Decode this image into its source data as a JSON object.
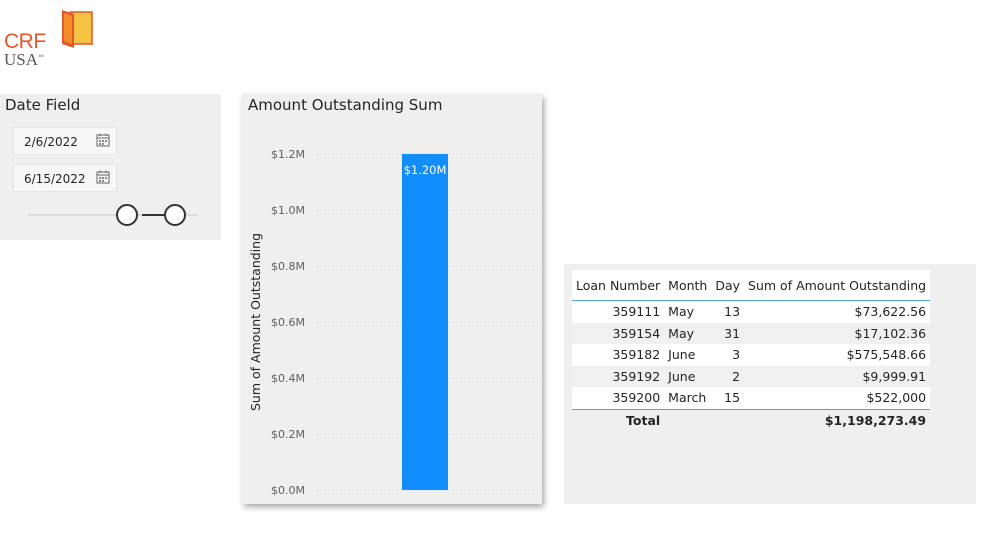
{
  "logo": {
    "line1": "CRF",
    "line2": "USA",
    "mark": "™"
  },
  "slicer": {
    "title": "Date Field",
    "start_date": "2/6/2022",
    "end_date": "6/15/2022"
  },
  "chart": {
    "title": "Amount Outstanding Sum"
  },
  "chart_data": {
    "type": "bar",
    "title": "Amount Outstanding Sum",
    "xlabel": "",
    "ylabel": "Sum of Amount Outstanding",
    "categories": [
      ""
    ],
    "values": [
      1.2
    ],
    "data_labels": [
      "$1.20M"
    ],
    "ylim": [
      0,
      1.2
    ],
    "yticks": [
      0.0,
      0.2,
      0.4,
      0.6,
      0.8,
      1.0,
      1.2
    ],
    "ytick_labels": [
      "$0.0M",
      "$0.2M",
      "$0.4M",
      "$0.6M",
      "$0.8M",
      "$1.0M",
      "$1.2M"
    ],
    "grid": true,
    "bar_color": "#118dff"
  },
  "table": {
    "headers": [
      "Loan Number",
      "Month",
      "Day",
      "Sum of Amount Outstanding"
    ],
    "rows": [
      [
        "359111",
        "May",
        "13",
        "$73,622.56"
      ],
      [
        "359154",
        "May",
        "31",
        "$17,102.36"
      ],
      [
        "359182",
        "June",
        "3",
        "$575,548.66"
      ],
      [
        "359192",
        "June",
        "2",
        "$9,999.91"
      ],
      [
        "359200",
        "March",
        "15",
        "$522,000"
      ]
    ],
    "total_label": "Total",
    "total_value": "$1,198,273.49"
  }
}
